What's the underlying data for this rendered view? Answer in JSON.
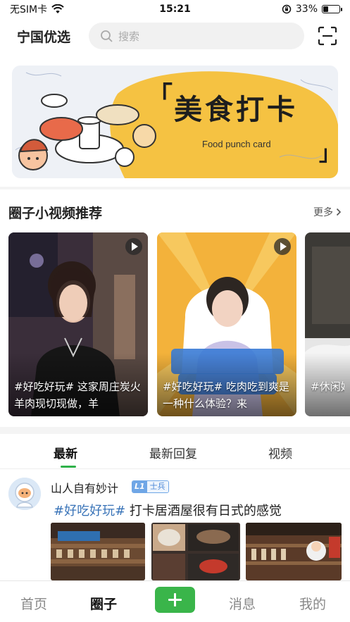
{
  "status": {
    "carrier": "无SIM卡",
    "time": "15:21",
    "battery_text": "33%",
    "battery_level": 0.33
  },
  "header": {
    "app_title": "宁国优选",
    "search_placeholder": "搜索"
  },
  "banner": {
    "title": "美食打卡",
    "bracket_left": "「",
    "bracket_right": "」",
    "subtitle": "Food punch card"
  },
  "videos": {
    "section_title": "圈子小视频推荐",
    "more_label": "更多",
    "items": [
      {
        "caption": "#好吃好玩# 这家周庄炭火羊肉现切现做，羊"
      },
      {
        "caption": "#好吃好玩# 吃肉吃到爽是一种什么体验？来"
      },
      {
        "caption": "#休闲娱乐# 楼天空"
      }
    ]
  },
  "tabs": {
    "items": [
      {
        "label": "最新"
      },
      {
        "label": "最新回复"
      },
      {
        "label": "视频"
      }
    ],
    "active_index": 0
  },
  "post": {
    "username": "山人自有妙计",
    "level_code": "L1",
    "level_name": "士兵",
    "tag": "#好吃好玩#",
    "text": " 打卡居酒屋很有日式的感觉"
  },
  "bottom_nav": {
    "items": [
      {
        "label": "首页"
      },
      {
        "label": "圈子"
      },
      {
        "label": "消息"
      },
      {
        "label": "我的"
      }
    ],
    "active_index": 1
  },
  "colors": {
    "accent_green": "#3ab54a",
    "tag_blue": "#3a74b8",
    "banner_yellow": "#f5c242"
  }
}
